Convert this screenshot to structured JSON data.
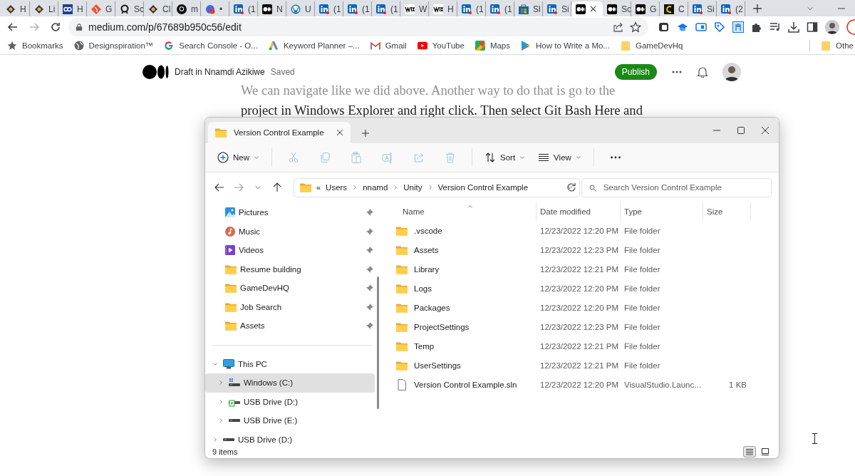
{
  "browser": {
    "tabs": [
      {
        "kind": "kite",
        "label": "H",
        "selected": false
      },
      {
        "kind": "kite",
        "label": "Li",
        "selected": false
      },
      {
        "kind": "co",
        "label": "H",
        "selected": false
      },
      {
        "kind": "git",
        "label": "G",
        "selected": false
      },
      {
        "kind": "q",
        "label": "Sc",
        "selected": false
      },
      {
        "kind": "kite",
        "label": "Cl",
        "selected": false
      },
      {
        "kind": "github",
        "label": "m",
        "selected": false
      },
      {
        "kind": "google",
        "label": "•",
        "selected": false
      },
      {
        "kind": "linkedin",
        "label": "(1",
        "selected": false
      },
      {
        "kind": "medium",
        "label": "N",
        "selected": false
      },
      {
        "kind": "wordpress",
        "label": "U",
        "selected": false
      },
      {
        "kind": "linkedin",
        "label": "(1",
        "selected": false
      },
      {
        "kind": "linkedin",
        "label": "(1",
        "selected": false
      },
      {
        "kind": "linkedin",
        "label": "(1",
        "selected": false
      },
      {
        "kind": "wix",
        "label": "W",
        "selected": false
      },
      {
        "kind": "wix",
        "label": "H",
        "selected": false
      },
      {
        "kind": "linkedin",
        "label": "(1",
        "selected": false
      },
      {
        "kind": "linkedin",
        "label": "(1",
        "selected": false
      },
      {
        "kind": "store",
        "label": "Sl",
        "selected": false
      },
      {
        "kind": "linkedin",
        "label": "Si",
        "selected": false
      },
      {
        "kind": "medium",
        "selected": true
      },
      {
        "kind": "medium",
        "label": "Sc",
        "selected": false
      },
      {
        "kind": "medium",
        "label": "G",
        "selected": false
      },
      {
        "kind": "c",
        "label": "C",
        "selected": false
      },
      {
        "kind": "linkedin",
        "label": "Si",
        "selected": false
      },
      {
        "kind": "linkedin",
        "label": "(2",
        "selected": false
      }
    ],
    "address": "medium.com/p/67689b950c56/edit",
    "bookmarks": [
      {
        "kind": "star",
        "label": "Bookmarks"
      },
      {
        "kind": "globe",
        "label": "Designspiration™"
      },
      {
        "kind": "google",
        "label": "Search Console - O..."
      },
      {
        "kind": "ads",
        "label": "Keyword Planner –..."
      },
      {
        "kind": "gmail",
        "label": "Gmail"
      },
      {
        "kind": "youtube",
        "label": "YouTube"
      },
      {
        "kind": "maps",
        "label": "Maps"
      },
      {
        "kind": "play",
        "label": "How to Write a Mo..."
      },
      {
        "kind": "folder",
        "label": "GameDevHq"
      }
    ],
    "other_bookmarks": "Othe"
  },
  "page": {
    "header": {
      "draft": "Draft in Nnamdi Azikiwe",
      "status": "Saved",
      "publish": "Publish"
    },
    "paragraph": [
      "We can navigate like we did above. Another way to do that is go to the",
      "project in Windows Explorer and right click. Then select Git Bash Here and"
    ]
  },
  "explorer": {
    "tab_title": "Version Control Example",
    "commands": [
      {
        "kind": "new",
        "label": "New",
        "disabled": false
      },
      {
        "kind": "cut",
        "disabled": true
      },
      {
        "kind": "copy",
        "disabled": true
      },
      {
        "kind": "paste",
        "disabled": true
      },
      {
        "kind": "rename",
        "disabled": true
      },
      {
        "kind": "share",
        "disabled": true
      },
      {
        "kind": "delete",
        "disabled": true
      },
      {
        "kind": "sort",
        "label": "Sort",
        "disabled": false
      },
      {
        "kind": "view",
        "label": "View",
        "disabled": false
      },
      {
        "kind": "more",
        "disabled": false
      }
    ],
    "overflow_mark": "«",
    "breadcrumb": [
      "Users",
      "nnamd",
      "Unity",
      "Version Control Example"
    ],
    "search": {
      "placeholder": "Search Version Control Example"
    },
    "quick_access": [
      {
        "kind": "pictures",
        "label": "Pictures",
        "pinned": true
      },
      {
        "kind": "music",
        "label": "Music",
        "pinned": true
      },
      {
        "kind": "videos",
        "label": "Videos",
        "pinned": true
      },
      {
        "kind": "folder",
        "label": "Resume building",
        "pinned": true
      },
      {
        "kind": "folder",
        "label": "GameDevHQ",
        "pinned": true
      },
      {
        "kind": "folder",
        "label": "Job Search",
        "pinned": true
      },
      {
        "kind": "folder",
        "label": "Assets",
        "pinned": true
      }
    ],
    "tree": [
      {
        "kind": "pc",
        "label": "This PC",
        "expanded": true,
        "selected": false,
        "children": [
          {
            "kind": "windows-drive",
            "label": "Windows (C:)",
            "expanded": false,
            "selected": true
          },
          {
            "kind": "usb-drive",
            "label": "USB Drive (D:)",
            "expanded": false,
            "selected": false
          },
          {
            "kind": "drive",
            "label": "USB Drive (E:)",
            "expanded": false,
            "selected": false
          }
        ]
      },
      {
        "kind": "drive",
        "label": "USB Drive (D:)",
        "expanded": false,
        "selected": false
      }
    ],
    "columns": [
      {
        "label": "Name",
        "sorted": true
      },
      {
        "label": "Date modified",
        "sorted": false
      },
      {
        "label": "Type",
        "sorted": false
      },
      {
        "label": "Size",
        "sorted": false
      }
    ],
    "files": [
      {
        "kind": "folder",
        "name": ".vscode",
        "date": "12/23/2022 12:20 PM",
        "type": "File folder"
      },
      {
        "kind": "folder",
        "name": "Assets",
        "date": "12/23/2022 12:23 PM",
        "type": "File folder"
      },
      {
        "kind": "folder",
        "name": "Library",
        "date": "12/23/2022 12:21 PM",
        "type": "File folder"
      },
      {
        "kind": "folder",
        "name": "Logs",
        "date": "12/23/2022 12:20 PM",
        "type": "File folder"
      },
      {
        "kind": "folder",
        "name": "Packages",
        "date": "12/23/2022 12:20 PM",
        "type": "File folder"
      },
      {
        "kind": "folder",
        "name": "ProjectSettings",
        "date": "12/23/2022 12:23 PM",
        "type": "File folder"
      },
      {
        "kind": "folder",
        "name": "Temp",
        "date": "12/23/2022 12:21 PM",
        "type": "File folder"
      },
      {
        "kind": "folder",
        "name": "UserSettings",
        "date": "12/23/2022 12:21 PM",
        "type": "File folder"
      },
      {
        "kind": "file",
        "name": "Version Control Example.sln",
        "date": "12/23/2022 12:20 PM",
        "type": "VisualStudio.Launc...",
        "size": "1 KB"
      }
    ],
    "status": "9 items",
    "view_modes": [
      {
        "kind": "details",
        "selected": true
      },
      {
        "kind": "tiles",
        "selected": false
      }
    ]
  }
}
